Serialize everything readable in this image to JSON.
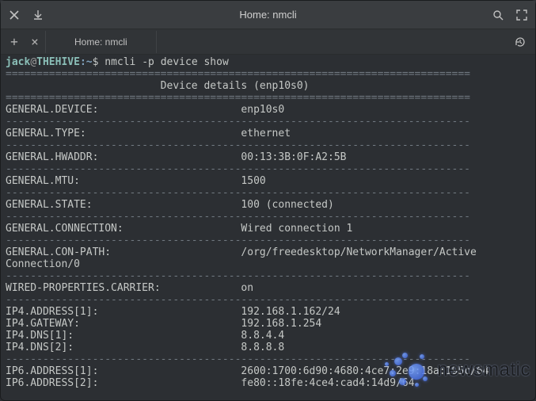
{
  "window": {
    "title": "Home: nmcli"
  },
  "tabbar": {
    "active_tab": "Home: nmcli"
  },
  "prompt": {
    "user": "jack",
    "host": "THEHIVE",
    "path": "~",
    "sep_at": "@",
    "sep_colon": ":",
    "dollar": "$",
    "command": "nmcli -p device show"
  },
  "output": {
    "rule_eq": "===========================================================================",
    "rule_dash": "---------------------------------------------------------------------------",
    "header": "Device details (enp10s0)",
    "rows": [
      {
        "key": "GENERAL.DEVICE:",
        "val": "enp10s0"
      },
      {
        "key": "GENERAL.TYPE:",
        "val": "ethernet"
      },
      {
        "key": "GENERAL.HWADDR:",
        "val": "00:13:3B:0F:A2:5B"
      },
      {
        "key": "GENERAL.MTU:",
        "val": "1500"
      },
      {
        "key": "GENERAL.STATE:",
        "val": "100 (connected)"
      },
      {
        "key": "GENERAL.CONNECTION:",
        "val": "Wired connection 1"
      },
      {
        "key": "GENERAL.CON-PATH:",
        "val": "/org/freedesktop/NetworkManager/ActiveConnection/0"
      },
      {
        "key": "WIRED-PROPERTIES.CARRIER:",
        "val": "on"
      }
    ],
    "ip4": [
      {
        "key": "IP4.ADDRESS[1]:",
        "val": "192.168.1.162/24"
      },
      {
        "key": "IP4.GATEWAY:",
        "val": "192.168.1.254"
      },
      {
        "key": "IP4.DNS[1]:",
        "val": "8.8.4.4"
      },
      {
        "key": "IP4.DNS[2]:",
        "val": "8.8.8.8"
      }
    ],
    "ip6": [
      {
        "key": "IP6.ADDRESS[1]:",
        "val": "2600:1700:6d90:4680:4ce7:2e9:18a:195c/64"
      },
      {
        "key": "IP6.ADDRESS[2]:",
        "val": "fe80::18fe:4ce4:cad4:14d9/64"
      }
    ]
  },
  "watermark": {
    "text": "newsmatic"
  }
}
